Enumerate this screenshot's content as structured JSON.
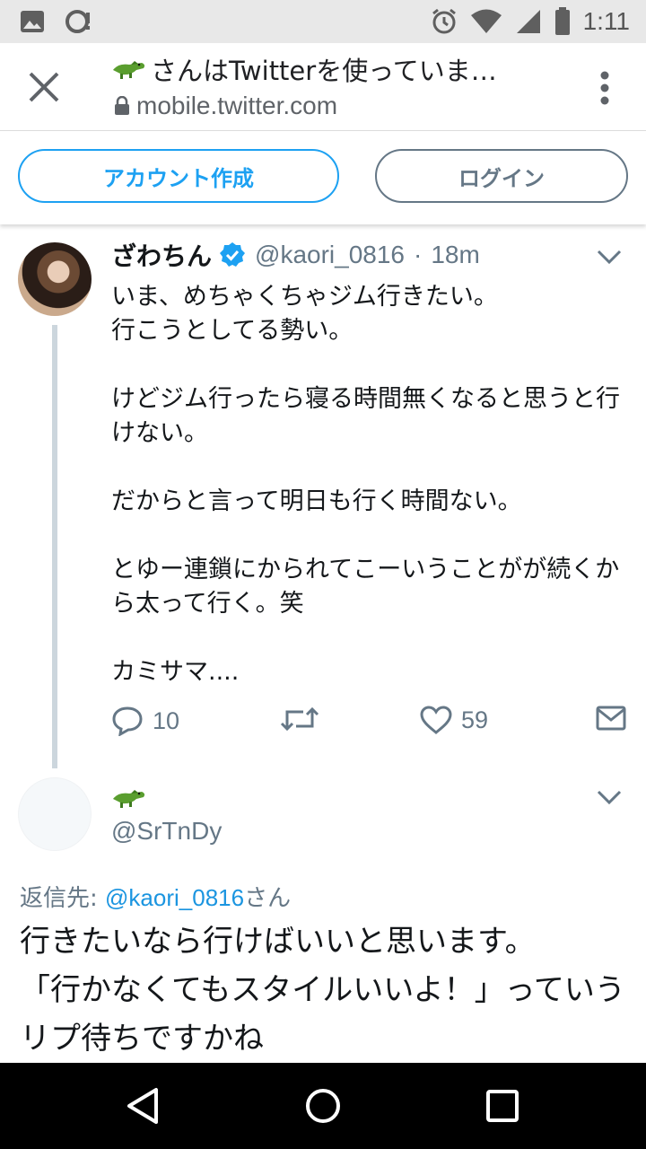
{
  "status_bar": {
    "time": "1:11",
    "icons": [
      "image-icon",
      "sync-icon",
      "alarm-icon",
      "wifi-icon",
      "signal-icon",
      "battery-icon"
    ]
  },
  "tab_bar": {
    "title": "さんはTwitterを使っていま…",
    "title_emoji": "crocodile-icon",
    "url": "mobile.twitter.com"
  },
  "auth": {
    "signup_label": "アカウント作成",
    "login_label": "ログイン"
  },
  "tweet": {
    "name": "ざわちん",
    "verified": true,
    "handle": "@kaori_0816",
    "separator": "·",
    "time": "18m",
    "body": "いま、めちゃくちゃジム行きたい。\n行こうとしてる勢い。\n\nけどジム行ったら寝る時間無くなると思うと行けない。\n\nだからと言って明日も行く時間ない。\n\nとゆー連鎖にかられてこーいうことがが続くから太って行く。笑\n\nカミサマ....",
    "replies": "10",
    "retweets": "",
    "likes": "59"
  },
  "reply": {
    "name_emoji": "crocodile-icon",
    "handle": "@SrTnDy",
    "replying_prefix": "返信先: ",
    "replying_handle": "@kaori_0816",
    "replying_suffix": "さん",
    "body": "行きたいなら行けばいいと思います。\n「行かなくてもスタイルいいよ！」っていうリプ待ちですかね"
  },
  "colors": {
    "twitter_blue": "#1da1f2",
    "link_blue": "#1b95e0",
    "secondary_text": "#657786",
    "thread_line": "#ccd6dd"
  }
}
